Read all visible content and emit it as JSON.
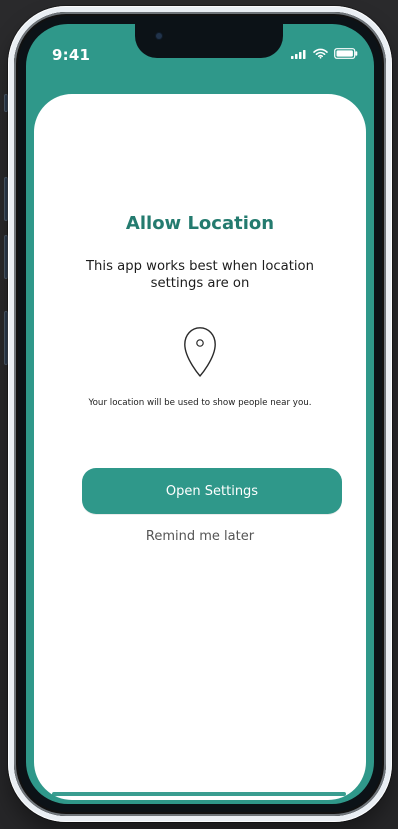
{
  "status_bar": {
    "time": "9:41",
    "icons": [
      "signal-icon",
      "wifi-icon",
      "battery-icon"
    ]
  },
  "permission_card": {
    "title": "Allow Location",
    "subtitle": "This app works best when location settings are on",
    "icon": "location-pin-icon",
    "note": "Your location will be used to show people near you.",
    "primary_button_label": "Open Settings",
    "secondary_action_label": "Remind me later"
  },
  "colors": {
    "accent": "#2f988a",
    "title": "#247b6f",
    "background": "#2a2a2c",
    "card": "#ffffff"
  }
}
